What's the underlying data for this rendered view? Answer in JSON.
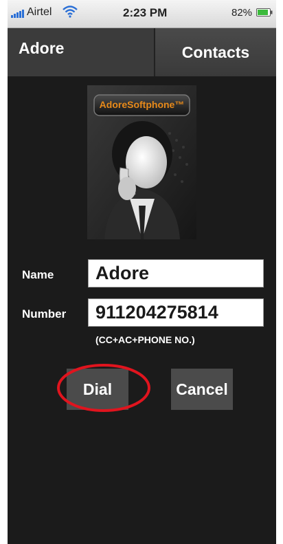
{
  "status_bar": {
    "carrier": "Airtel",
    "time": "2:23 PM",
    "battery_percent": "82%",
    "icons": [
      "signal-bars-icon",
      "wifi-icon",
      "battery-icon"
    ]
  },
  "header": {
    "title": "Adore",
    "contacts_label": "Contacts"
  },
  "logo": {
    "brand_text": "AdoreSoftphone™",
    "image": "person-on-phone-avatar"
  },
  "form": {
    "name_label": "Name",
    "name_value": "Adore",
    "number_label": "Number",
    "number_value": "911204275814",
    "number_hint": "(CC+AC+PHONE NO.)"
  },
  "buttons": {
    "dial_label": "Dial",
    "cancel_label": "Cancel"
  },
  "colors": {
    "background": "#1b1b1b",
    "header": "#3b3b3b",
    "button": "#4b4b4b",
    "highlight_ellipse": "#e0141e",
    "brand_orange": "#e88a1a"
  }
}
